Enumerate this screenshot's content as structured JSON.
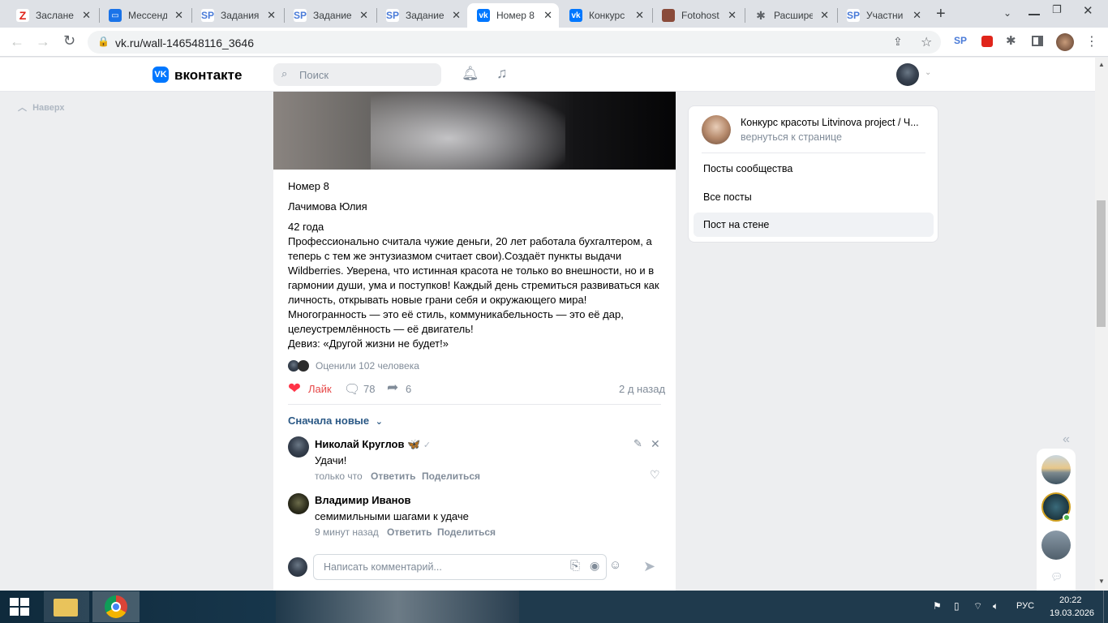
{
  "browser": {
    "tabs": [
      {
        "title": "Заслане",
        "icon": "z-icon",
        "color": "#e0251b"
      },
      {
        "title": "Мессенд",
        "icon": "messenger-icon",
        "color": "#1a73e8"
      },
      {
        "title": "Задания",
        "icon": "sp-icon",
        "color": "#4a7bd8"
      },
      {
        "title": "Задание",
        "icon": "sp-icon",
        "color": "#4a7bd8"
      },
      {
        "title": "Задание",
        "icon": "sp-icon",
        "color": "#4a7bd8"
      },
      {
        "title": "Номер 8",
        "icon": "vk-icon",
        "color": "#0077ff"
      },
      {
        "title": "Конкурс",
        "icon": "vk-icon",
        "color": "#0077ff"
      },
      {
        "title": "Fotohost",
        "icon": "photo-icon",
        "color": "#8a4b3a"
      },
      {
        "title": "Расшире",
        "icon": "puzzle-icon",
        "color": "#5f6368"
      },
      {
        "title": "Участни",
        "icon": "sp-icon",
        "color": "#4a7bd8"
      }
    ],
    "url": "vk.ru/wall-146548116_3646"
  },
  "vk": {
    "logo": "вконтакте",
    "search_placeholder": "Поиск",
    "up_button": "Наверх"
  },
  "post": {
    "title": "Номер 8",
    "name": "Лачимова Юлия",
    "lines": [
      "42 года",
      "Профессионально считала чужие деньги, 20 лет работала бухгалтером, а",
      "теперь с тем же энтузиазмом считает свои).Создаёт пункты выдачи",
      "Wildberries. Уверена, что истинная красота не только во внешности, но и в",
      "гармонии души, ума и поступков! Каждый день стремиться развиваться как",
      "личность, открывать новые грани себя и окружающего мира!",
      "Многогранность — это её стиль, коммуникабельность — это её дар,",
      "целеустремлённость — её двигатель!",
      "Девиз: «Другой жизни не будет!»"
    ],
    "rated": "Оценили 102 человека",
    "like_label": "Лайк",
    "comments_count": "78",
    "shares_count": "6",
    "time": "2 д назад",
    "sort_label": "Сначала новые"
  },
  "comments": [
    {
      "author": "Николай Круглов",
      "emoji": "🦋",
      "text": "Удачи!",
      "time": "только что",
      "reply": "Ответить",
      "share": "Поделиться"
    },
    {
      "author": "Владимир Иванов",
      "text": "семимильными шагами к удаче",
      "time": "9 минут назад",
      "reply": "Ответить",
      "share": "Поделиться"
    }
  ],
  "comment_input_placeholder": "Написать комментарий...",
  "sidebar": {
    "group_name": "Конкурс красоты Litvinova project / Ч...",
    "back_link": "вернуться к странице",
    "items": [
      "Посты сообщества",
      "Все посты",
      "Пост на стене"
    ],
    "active_index": 2
  },
  "taskbar": {
    "lang": "РУС",
    "time": "20:22",
    "date": "19.03.2026"
  }
}
